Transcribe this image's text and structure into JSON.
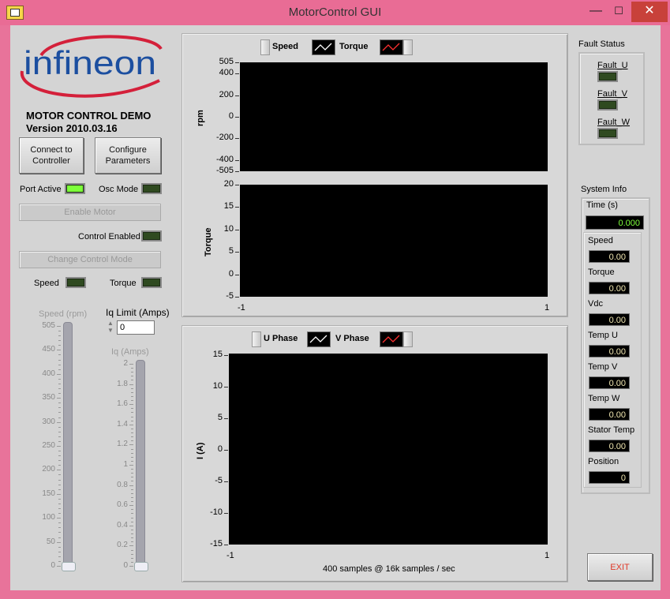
{
  "window": {
    "title": "MotorControl GUI",
    "min_glyph": "—",
    "max_glyph": "☐",
    "close_glyph": "✕"
  },
  "logo": {
    "text": "infineon"
  },
  "demo": {
    "title": "MOTOR CONTROL DEMO",
    "version": "Version 2010.03.16"
  },
  "buttons": {
    "connect_line1": "Connect to",
    "connect_line2": "Controller",
    "configure_line1": "Configure",
    "configure_line2": "Parameters",
    "enable_motor": "Enable Motor",
    "change_mode": "Change Control Mode",
    "exit": "EXIT"
  },
  "indicators": {
    "port_active": {
      "label": "Port Active",
      "on": true
    },
    "osc_mode": {
      "label": "Osc Mode",
      "on": false
    },
    "control_enabled": {
      "label": "Control Enabled",
      "on": false
    },
    "speed": {
      "label": "Speed",
      "on": false
    },
    "torque": {
      "label": "Torque",
      "on": false
    }
  },
  "speed_slider": {
    "title": "Speed (rpm)",
    "ticks": [
      "505",
      "450",
      "400",
      "350",
      "300",
      "250",
      "200",
      "150",
      "100",
      "50",
      "0"
    ],
    "value": 0
  },
  "iq_limit": {
    "label": "Iq Limit (Amps)",
    "value": "0"
  },
  "iq_slider": {
    "title": "Iq (Amps)",
    "ticks": [
      "2",
      "1.8",
      "1.6",
      "1.4",
      "1.2",
      "1",
      "0.8",
      "0.6",
      "0.4",
      "0.2",
      "0"
    ],
    "value": 0
  },
  "top_chart": {
    "legend": [
      {
        "name": "Speed"
      },
      {
        "name": "Torque"
      }
    ],
    "speed_plot": {
      "ylabel": "rpm",
      "yticks": [
        "505",
        "400",
        "200",
        "0",
        "-200",
        "-400",
        "-505"
      ]
    },
    "torque_plot": {
      "ylabel": "Torque",
      "yticks": [
        "20",
        "15",
        "10",
        "5",
        "0",
        "-5"
      ],
      "xticks": [
        "-1",
        "1"
      ]
    }
  },
  "bottom_chart": {
    "legend": [
      {
        "name": "U Phase"
      },
      {
        "name": "V Phase"
      }
    ],
    "ylabel": "I (A)",
    "yticks": [
      "15",
      "10",
      "5",
      "0",
      "-5",
      "-10",
      "-15"
    ],
    "xticks": [
      "-1",
      "1"
    ],
    "caption": "400 samples @ 16k samples / sec"
  },
  "fault_status": {
    "title": "Fault Status",
    "items": [
      {
        "label": "Fault_U",
        "on": false
      },
      {
        "label": "Fault_V",
        "on": false
      },
      {
        "label": "Fault_W",
        "on": false
      }
    ]
  },
  "system_info": {
    "title": "System Info",
    "time": {
      "label": "Time (s)",
      "value": "0.000"
    },
    "fields": [
      {
        "label": "Speed",
        "value": "0.00"
      },
      {
        "label": "Torque",
        "value": "0.00"
      },
      {
        "label": "Vdc",
        "value": "0.00"
      },
      {
        "label": "Temp U",
        "value": "0.00"
      },
      {
        "label": "Temp V",
        "value": "0.00"
      },
      {
        "label": "Temp W",
        "value": "0.00"
      },
      {
        "label": "Stator Temp",
        "value": "0.00"
      },
      {
        "label": "Position",
        "value": "0"
      }
    ]
  },
  "colors": {
    "window_frame": "#e96c95",
    "led_on": "#7dff3a",
    "led_off": "#2f4a20",
    "time_value": "#7dff3a",
    "exit_text": "#e03a2a",
    "logo_blue": "#1c4fa0",
    "logo_red": "#d4203a"
  }
}
